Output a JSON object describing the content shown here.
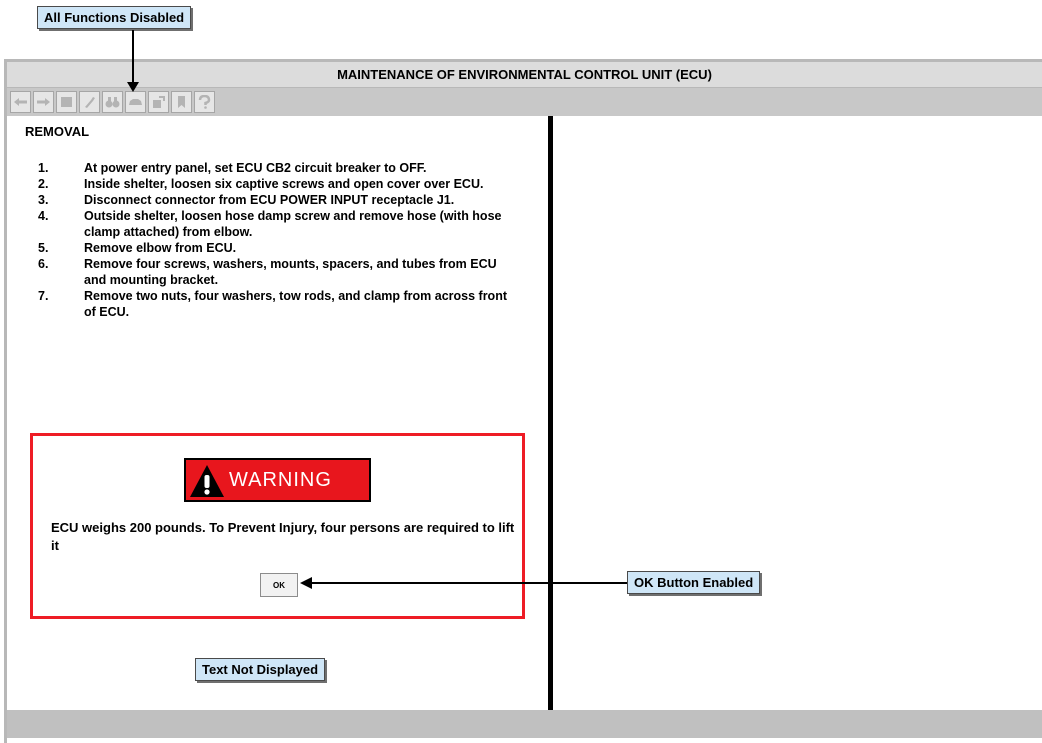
{
  "callouts": {
    "top": "All Functions Disabled",
    "ok": "OK Button Enabled",
    "text": "Text Not Displayed"
  },
  "window": {
    "title": "MAINTENANCE OF ENVIRONMENTAL CONTROL UNIT (ECU)"
  },
  "toolbar": {
    "buttons": [
      {
        "icon": "arrow-left-icon",
        "disabled": true
      },
      {
        "icon": "arrow-right-icon",
        "disabled": true
      },
      {
        "icon": "stop-icon",
        "disabled": true
      },
      {
        "icon": "tool-icon",
        "disabled": true
      },
      {
        "icon": "binoculars-icon",
        "disabled": true
      },
      {
        "icon": "car-icon",
        "disabled": true
      },
      {
        "icon": "exit-icon",
        "disabled": true
      },
      {
        "icon": "bookmark-icon",
        "disabled": true
      },
      {
        "icon": "help-icon",
        "disabled": true
      }
    ]
  },
  "procedure": {
    "section": "REMOVAL",
    "steps": [
      {
        "num": "1.",
        "text": "At power entry panel, set ECU CB2 circuit breaker to OFF."
      },
      {
        "num": "2.",
        "text": "Inside shelter, loosen six captive screws and open cover over ECU."
      },
      {
        "num": "3.",
        "text": "Disconnect connector from ECU POWER INPUT receptacle J1."
      },
      {
        "num": "4.",
        "text": "Outside shelter, loosen hose damp screw and remove hose (with hose clamp attached) from elbow."
      },
      {
        "num": "5.",
        "text": "Remove elbow from ECU."
      },
      {
        "num": "6.",
        "text": "Remove four screws, washers, mounts, spacers, and tubes from ECU and mounting bracket."
      },
      {
        "num": "7.",
        "text": "Remove two nuts, four washers, tow rods, and clamp from across front of ECU."
      }
    ]
  },
  "warning": {
    "label": "WARNING",
    "message": "ECU weighs 200 pounds. To Prevent Injury, four persons are required to lift it",
    "ok_label": "OK"
  },
  "colors": {
    "warning_red": "#e8161d",
    "callout_bg": "#cfe6f7",
    "title_bar": "#dcdcdc",
    "toolbar": "#c8c8c8"
  }
}
